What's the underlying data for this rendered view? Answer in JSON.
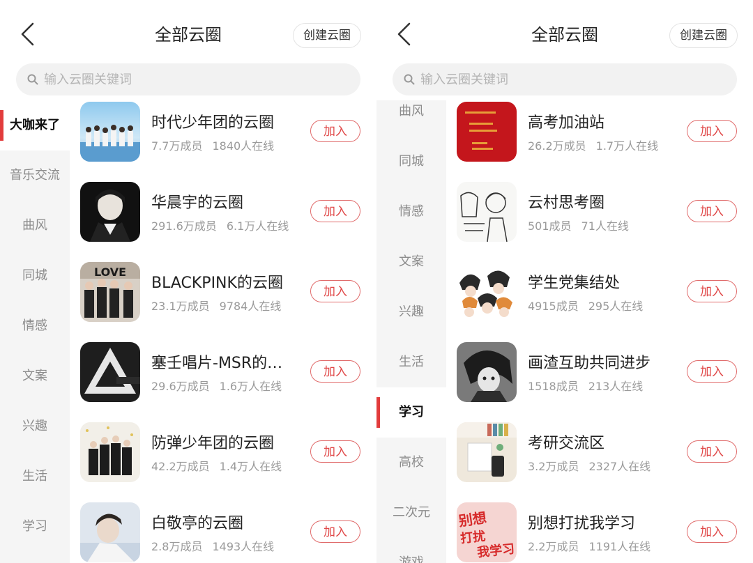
{
  "colors": {
    "accent": "#e23c3c",
    "join_border": "#e06a6a",
    "sidebar_bg": "#f5f5f5",
    "search_bg": "#f2f2f2"
  },
  "left": {
    "header": {
      "title": "全部云圈",
      "create_label": "创建云圈"
    },
    "search": {
      "placeholder": "输入云圈关键词"
    },
    "sidebar": [
      {
        "label": "大咖来了",
        "active": true
      },
      {
        "label": "音乐交流"
      },
      {
        "label": "曲风"
      },
      {
        "label": "同城"
      },
      {
        "label": "情感"
      },
      {
        "label": "文案"
      },
      {
        "label": "兴趣"
      },
      {
        "label": "生活"
      },
      {
        "label": "学习"
      }
    ],
    "items": [
      {
        "name": "时代少年团的云圈",
        "members": "7.7万成员",
        "online": "1840人在线",
        "join": "加入"
      },
      {
        "name": "华晨宇的云圈",
        "members": "291.6万成员",
        "online": "6.1万人在线",
        "join": "加入"
      },
      {
        "name": "BLACKPINK的云圈",
        "members": "23.1万成员",
        "online": "9784人在线",
        "join": "加入",
        "thumb_text": "LOVE"
      },
      {
        "name": "塞壬唱片-MSR的云圈",
        "members": "29.6万成员",
        "online": "1.6万人在线",
        "join": "加入"
      },
      {
        "name": "防弹少年团的云圈",
        "members": "42.2万成员",
        "online": "1.4万人在线",
        "join": "加入"
      },
      {
        "name": "白敬亭的云圈",
        "members": "2.8万成员",
        "online": "1493人在线",
        "join": "加入"
      }
    ]
  },
  "right": {
    "header": {
      "title": "全部云圈",
      "create_label": "创建云圈"
    },
    "search": {
      "placeholder": "输入云圈关键词"
    },
    "sidebar": [
      {
        "label": "曲风"
      },
      {
        "label": "同城"
      },
      {
        "label": "情感"
      },
      {
        "label": "文案"
      },
      {
        "label": "兴趣"
      },
      {
        "label": "生活"
      },
      {
        "label": "学习",
        "active": true
      },
      {
        "label": "高校"
      },
      {
        "label": "二次元"
      },
      {
        "label": "游戏"
      }
    ],
    "items": [
      {
        "name": "高考加油站",
        "members": "26.2万成员",
        "online": "1.7万人在线",
        "join": "加入"
      },
      {
        "name": "云村思考圈",
        "members": "501成员",
        "online": "71人在线",
        "join": "加入"
      },
      {
        "name": "学生党集结处",
        "members": "4915成员",
        "online": "295人在线",
        "join": "加入"
      },
      {
        "name": "画渣互助共同进步",
        "members": "1518成员",
        "online": "213人在线",
        "join": "加入"
      },
      {
        "name": "考研交流区",
        "members": "3.2万成员",
        "online": "2327人在线",
        "join": "加入"
      },
      {
        "name": "别想打扰我学习",
        "members": "2.2万成员",
        "online": "1191人在线",
        "join": "加入",
        "thumb_text": "别想打扰我学习"
      }
    ]
  }
}
